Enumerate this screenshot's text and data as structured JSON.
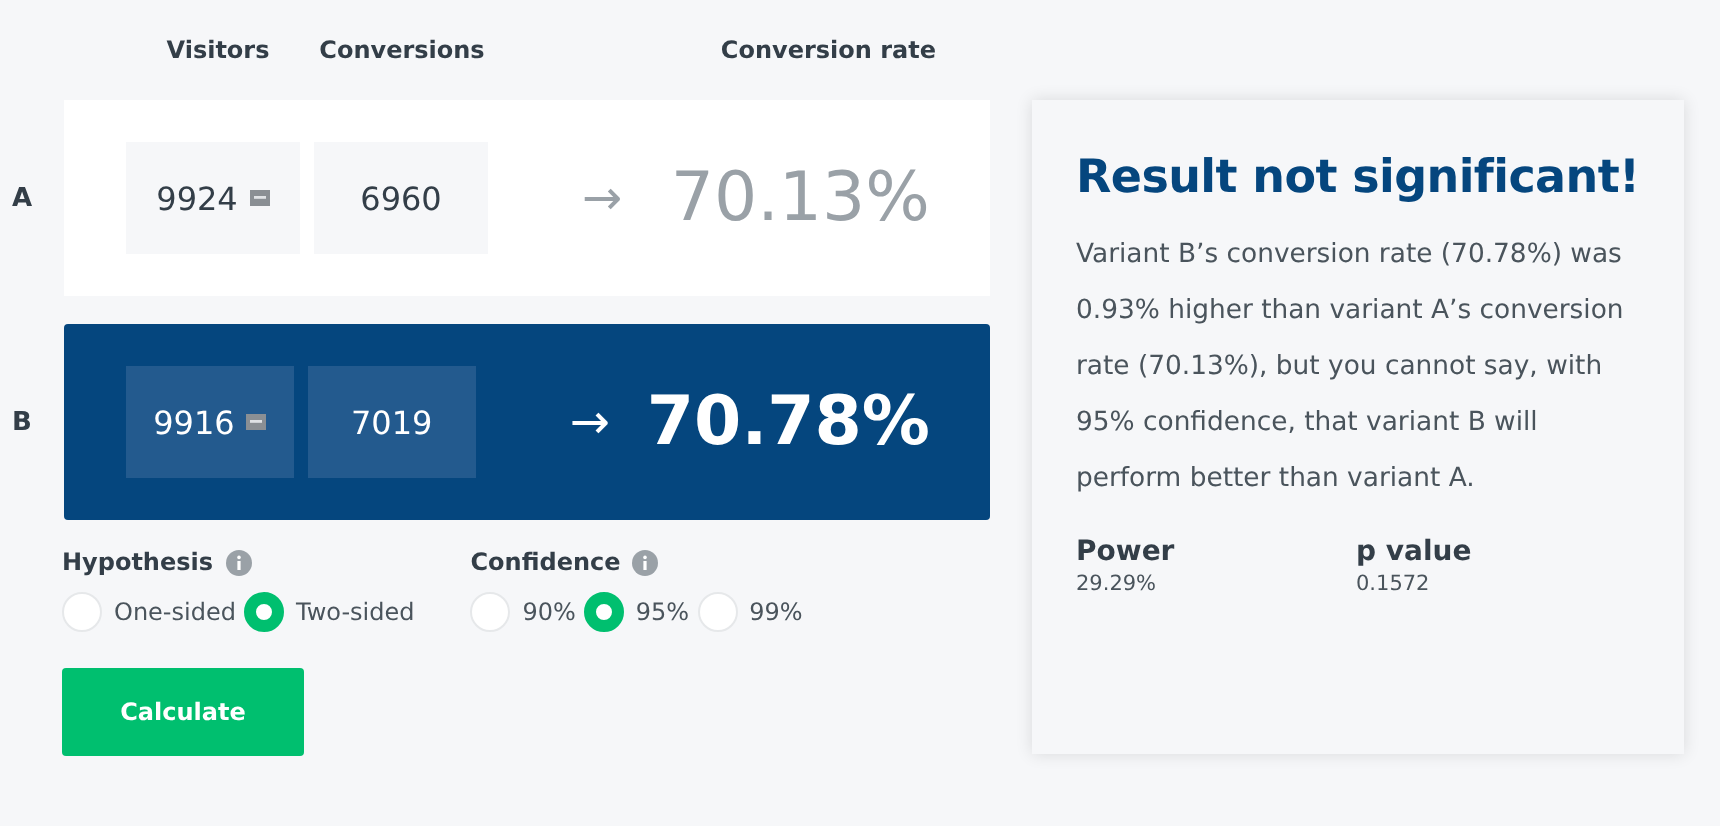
{
  "columns": [
    "Visitors",
    "Conversions",
    "Conversion rate"
  ],
  "variants": [
    {
      "label": "A",
      "visitors": "9924",
      "conversions": "6960",
      "arrow": "→",
      "rate": "70.13%",
      "selected": false
    },
    {
      "label": "B",
      "visitors": "9916",
      "conversions": "7019",
      "arrow": "→",
      "rate": "70.78%",
      "selected": true
    }
  ],
  "options": [
    {
      "title": "Hypothesis",
      "choices": [
        {
          "label": "One-sided",
          "selected": false
        },
        {
          "label": "Two-sided",
          "selected": true
        }
      ]
    },
    {
      "title": "Confidence",
      "choices": [
        {
          "label": "90%",
          "selected": false
        },
        {
          "label": "95%",
          "selected": true
        },
        {
          "label": "99%",
          "selected": false
        }
      ]
    }
  ],
  "calculate_button": "Calculate",
  "result": {
    "title": "Result not significant!",
    "text": "Variant B’s conversion rate (70.78%) was 0.93% higher than variant A’s conversion rate (70.13%), but you cannot say, with 95% confidence, that variant B will perform better than variant A.",
    "stats": [
      {
        "label": "Power",
        "value": "29.29%"
      },
      {
        "label": "p value",
        "value": "0.1572"
      }
    ]
  }
}
